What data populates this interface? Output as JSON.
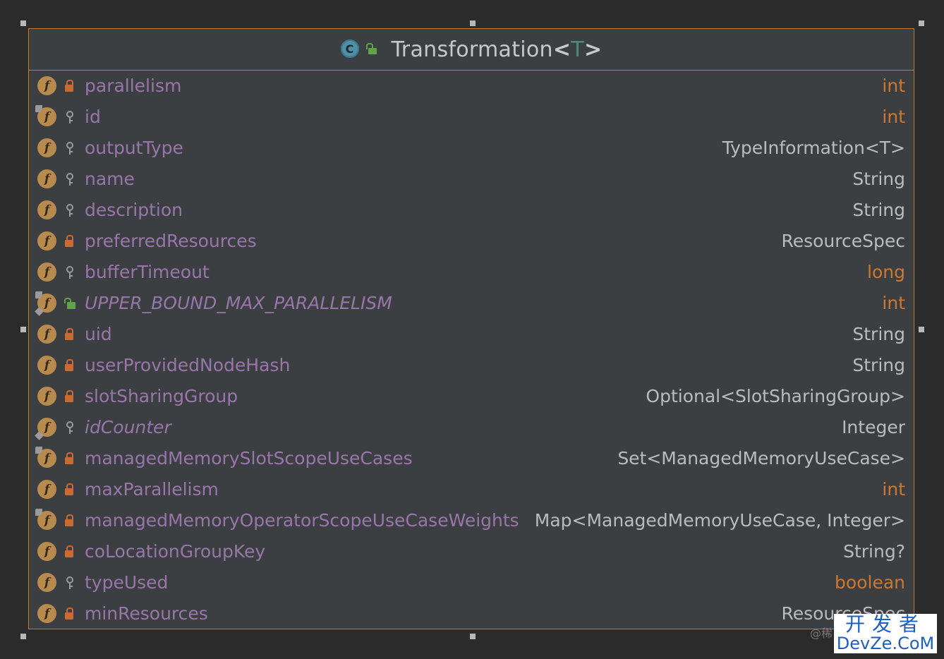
{
  "class": {
    "icon_letter": "C",
    "name": "Transformation",
    "type_param": "T",
    "lt": "<",
    "gt": ">"
  },
  "fields": [
    {
      "name": "parallelism",
      "type": "int",
      "visibility": "private",
      "primitive": true
    },
    {
      "name": "id",
      "type": "int",
      "visibility": "package",
      "primitive": true,
      "pinned": true
    },
    {
      "name": "outputType",
      "type": "TypeInformation<T>",
      "visibility": "package"
    },
    {
      "name": "name",
      "type": "String",
      "visibility": "package"
    },
    {
      "name": "description",
      "type": "String",
      "visibility": "package"
    },
    {
      "name": "preferredResources",
      "type": "ResourceSpec",
      "visibility": "private"
    },
    {
      "name": "bufferTimeout",
      "type": "long",
      "visibility": "package",
      "primitive": true
    },
    {
      "name": "UPPER_BOUND_MAX_PARALLELISM",
      "type": "int",
      "visibility": "public",
      "primitive": true,
      "static": true,
      "pinned": true,
      "italic": true
    },
    {
      "name": "uid",
      "type": "String",
      "visibility": "private"
    },
    {
      "name": "userProvidedNodeHash",
      "type": "String",
      "visibility": "private"
    },
    {
      "name": "slotSharingGroup",
      "type": "Optional<SlotSharingGroup>",
      "visibility": "private"
    },
    {
      "name": "idCounter",
      "type": "Integer",
      "visibility": "package",
      "static": true,
      "italic": true
    },
    {
      "name": "managedMemorySlotScopeUseCases",
      "type": "Set<ManagedMemoryUseCase>",
      "visibility": "private",
      "pinned": true
    },
    {
      "name": "maxParallelism",
      "type": "int",
      "visibility": "private",
      "primitive": true
    },
    {
      "name": "managedMemoryOperatorScopeUseCaseWeights",
      "type": "Map<ManagedMemoryUseCase, Integer>",
      "visibility": "private",
      "pinned": true
    },
    {
      "name": "coLocationGroupKey",
      "type": "String?",
      "visibility": "private"
    },
    {
      "name": "typeUsed",
      "type": "boolean",
      "visibility": "package",
      "primitive": true
    },
    {
      "name": "minResources",
      "type": "ResourceSpec",
      "visibility": "private"
    }
  ],
  "watermark": {
    "top": "开发者",
    "bottom": "DevZe.CoM",
    "side": "@稀"
  }
}
